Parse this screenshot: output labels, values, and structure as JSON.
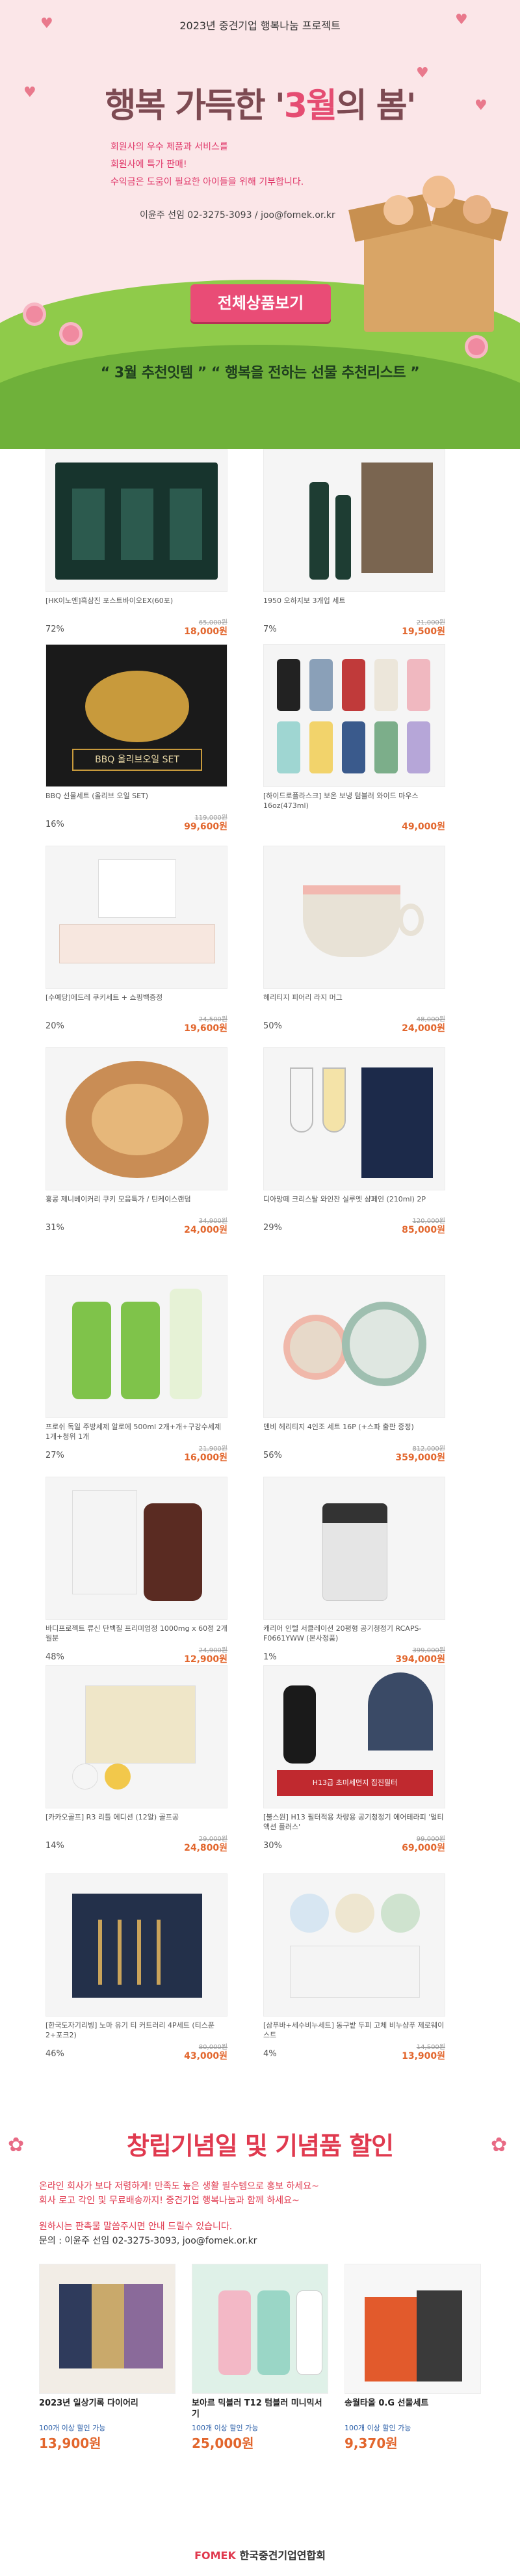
{
  "hero": {
    "project_label": "2023년 중견기업 행복나눔 프로젝트",
    "title_prefix": "행복 가득한 '",
    "title_accent": "3월",
    "title_suffix": "의 봄'",
    "bullets": [
      "회원사의 우수 제품과 서비스를",
      "회원사에 특가 판매!",
      "수익금은 도움이 필요한 아이들을 위해 기부합니다."
    ],
    "contact": "이윤주 선임 02-3275-3093 / joo@fomek.or.kr",
    "cta_label": "전체상품보기",
    "recommend": "“ 3월 추천잇템 ” “ 행복을 전하는 선물 추천리스트 ”",
    "colors": {
      "accent": "#e94c76",
      "title": "#7d4a52",
      "grass": "#8fcb4a"
    }
  },
  "products": [
    {
      "name": "[HK이노엔]흑삼진 포스트바이오EX(60포)",
      "pct": "72%",
      "orig": "65,000원",
      "price": "18,000원"
    },
    {
      "name": "1950 오하지보 3개입 세트",
      "pct": "7%",
      "orig": "21,000원",
      "price": "19,500원"
    },
    {
      "name": "BBQ 선물세트 (올리브 오일 SET)",
      "pct": "16%",
      "orig": "119,000원",
      "price": "99,600원"
    },
    {
      "name": "[하이드로플라스크] 보온 보냉 텀블러 와이드 마우스 16oz(473ml)",
      "pct": "",
      "orig": "",
      "price": "49,000원"
    },
    {
      "name": "[수예당]에드레 쿠키세트 + 쇼핑백증정",
      "pct": "20%",
      "orig": "24,500원",
      "price": "19,600원"
    },
    {
      "name": "헤리티지 피어리 라지 머그",
      "pct": "50%",
      "orig": "48,000원",
      "price": "24,000원"
    },
    {
      "name": "홍콩 제니베이커리 쿠키 모음특가 / 틴케이스랜덤",
      "pct": "31%",
      "orig": "34,900원",
      "price": "24,000원"
    },
    {
      "name": "디아망떼 크리스탈 와인잔 실루엣 샴페인 (210ml) 2P",
      "pct": "29%",
      "orig": "120,000원",
      "price": "85,000원"
    },
    {
      "name": "프로쉬 독일 주방세제 알로에 500ml 2개+개+구강수세제 1개+청위 1개",
      "pct": "27%",
      "orig": "21,900원",
      "price": "16,000원"
    },
    {
      "name": "덴비 헤리티지 4인조 세트 16P (+스파 출판 증정)",
      "pct": "56%",
      "orig": "812,000원",
      "price": "359,000원"
    },
    {
      "name": "바디프로젝트 류신 단백질 프리미엄정 1000mg x 60정 2개월분",
      "pct": "48%",
      "orig": "24,900원",
      "price": "12,900원"
    },
    {
      "name": "캐리어 인텔 서클레이션 20평형 공기청정기 RCAPS-F0661YWW (본사정품)",
      "pct": "1%",
      "orig": "399,000원",
      "price": "394,000원"
    },
    {
      "name": "[카카오골프] R3 리틀 에디션 (12알) 골프공",
      "pct": "14%",
      "orig": "29,000원",
      "price": "24,800원"
    },
    {
      "name": "[불스원] H13 필터적용 차량용 공기청정기 에어테라피 '멀티액션 플러스'",
      "pct": "30%",
      "orig": "99,000원",
      "price": "69,000원"
    },
    {
      "name": "[한국도자기리빙] 노마 유기 티 커트러리 4P세트 (티스푼2+포크2)",
      "pct": "46%",
      "orig": "80,000원",
      "price": "43,000원"
    },
    {
      "name": "[삼푸바+세수비누세트] 동구밭 두피 고체 비누샴푸 제로웨이스트",
      "pct": "4%",
      "orig": "14,500원",
      "price": "13,900원"
    }
  ],
  "anniversary": {
    "title": "창립기념일 및 기념품 할인",
    "lines": [
      "온라인 회사가 보다 저렴하게! 만족도 높은 생활 필수템으로 홍보 하세요~",
      "회사 로고 각인 및 무료배송까지! 중견기업 행복나눔과 함께 하세요~"
    ],
    "note": "원하시는 판촉물 말씀주시면 안내 드릴수 있습니다.",
    "contact": "문의 : 이윤주 선임 02-3275-3093, joo@fomek.or.kr",
    "items": [
      {
        "name": "2023년 일상기록 다이어리",
        "moq": "100개 이상 할인 가능",
        "price": "13,900원"
      },
      {
        "name": "보아르 믹블러 T12 텀블러 미니믹서기",
        "moq": "100개 이상 할인 가능",
        "price": "25,000원"
      },
      {
        "name": "송월타올 0.G 선물세트",
        "moq": "100개 이상 할인 가능",
        "price": "9,370원"
      }
    ],
    "footer_brand": "FOMEK",
    "footer_org": "한국중견기업연합회"
  }
}
